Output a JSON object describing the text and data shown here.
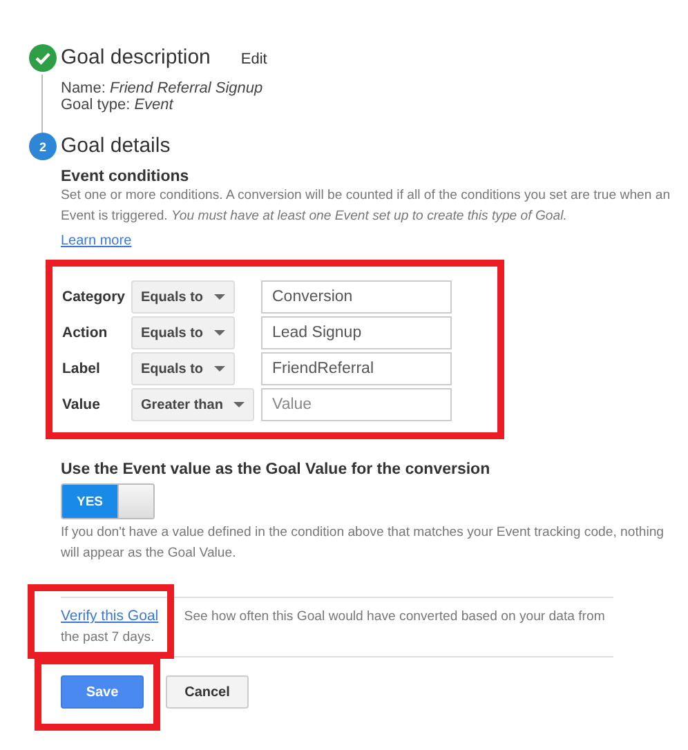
{
  "steps": [
    {
      "kind": "done",
      "title": "Goal description",
      "edit": "Edit",
      "details": [
        {
          "label": "Name:",
          "value": "Friend Referral Signup"
        },
        {
          "label": "Goal type:",
          "value": "Event"
        }
      ]
    },
    {
      "number": "2",
      "kind": "current",
      "title": "Goal details"
    }
  ],
  "event_conditions": {
    "heading": "Event conditions",
    "description": "Set one or more conditions. A conversion will be counted if all of the conditions you set are true when an Event is triggered. *You must have at least one Event set up to create this type of Goal.*",
    "learn_more": "Learn more",
    "highlighted": true,
    "rows": [
      {
        "label": "Category",
        "operator": "Equals to",
        "value": "Conversion"
      },
      {
        "label": "Action",
        "operator": "Equals to",
        "value": "Lead Signup"
      },
      {
        "label": "Label",
        "operator": "Equals to",
        "value": "FriendReferral"
      },
      {
        "label": "Value",
        "operator": "Greater than",
        "placeholder": "Value"
      }
    ]
  },
  "goal_value": {
    "heading": "Use the Event value as the Goal Value for the conversion",
    "toggle": {
      "label": "YES",
      "on": true
    },
    "help": "If you don't have a value defined in the condition above that matches your Event tracking code, nothing will appear as the Goal Value."
  },
  "verify": {
    "link": "Verify this Goal",
    "highlighted": true,
    "text": "See how often this Goal would have converted based on your data from the past 7 days."
  },
  "buttons": [
    {
      "label": "Save",
      "kind": "primary",
      "highlighted": true
    },
    {
      "label": "Cancel",
      "kind": "secondary",
      "highlighted": false
    }
  ]
}
